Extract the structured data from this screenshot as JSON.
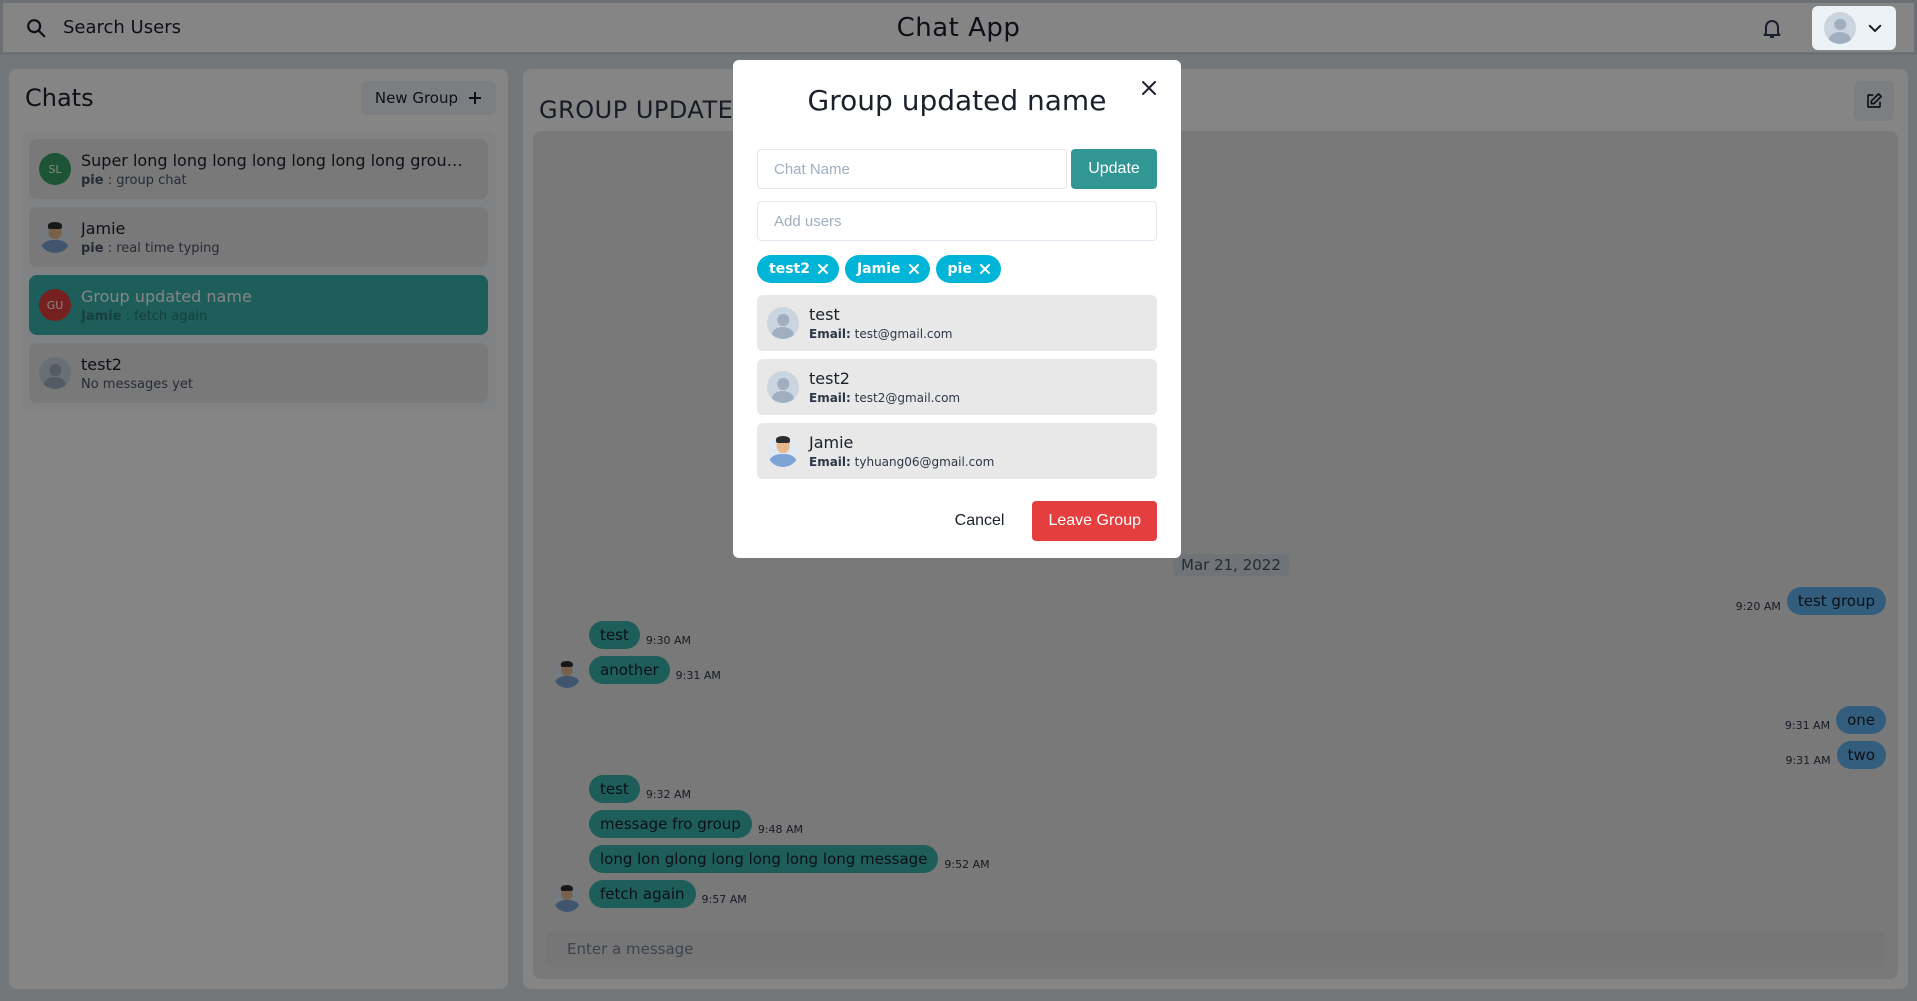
{
  "header": {
    "search_label": "Search Users",
    "app_title": "Chat App"
  },
  "chats_panel": {
    "title": "Chats",
    "new_group_label": "New Group",
    "items": [
      {
        "initials": "SL",
        "name": "Super long long long long long long long group...",
        "sender": "pie",
        "preview": "group chat",
        "avatar_color": "#38a169"
      },
      {
        "name": "Jamie",
        "sender": "pie",
        "preview": "real time typing"
      },
      {
        "initials": "GU",
        "name": "Group updated name",
        "sender": "Jamie",
        "preview": "fetch again",
        "avatar_color": "#e53e3e"
      },
      {
        "name": "test2",
        "preview": "No messages yet"
      }
    ]
  },
  "chat_panel": {
    "title": "GROUP UPDATED",
    "date_divider": "Mar 21, 2022",
    "input_placeholder": "Enter a message",
    "messages": [
      {
        "text": "test group",
        "time": "9:20 AM",
        "side": "out"
      },
      {
        "text": "test",
        "time": "9:30 AM",
        "side": "in"
      },
      {
        "text": "another",
        "time": "9:31 AM",
        "side": "in"
      },
      {
        "text": "one",
        "time": "9:31 AM",
        "side": "out"
      },
      {
        "text": "two",
        "time": "9:31 AM",
        "side": "out"
      },
      {
        "text": "test",
        "time": "9:32 AM",
        "side": "in"
      },
      {
        "text": "message fro group",
        "time": "9:48 AM",
        "side": "in"
      },
      {
        "text": "long lon glong long long long long message",
        "time": "9:52 AM",
        "side": "in"
      },
      {
        "text": "fetch again",
        "time": "9:57 AM",
        "side": "in"
      }
    ]
  },
  "modal": {
    "title": "Group updated name",
    "chat_name_placeholder": "Chat Name",
    "update_label": "Update",
    "add_users_placeholder": "Add users",
    "tags": [
      "test2",
      "Jamie",
      "pie"
    ],
    "email_prefix": "Email:",
    "users": [
      {
        "name": "test",
        "email": "test@gmail.com"
      },
      {
        "name": "test2",
        "email": "test2@gmail.com"
      },
      {
        "name": "Jamie",
        "email": "tyhuang06@gmail.com"
      }
    ],
    "cancel_label": "Cancel",
    "leave_label": "Leave Group"
  },
  "colors": {
    "teal": "#38b2ac",
    "blue_bubble": "#63b3ed",
    "tag_cyan": "#00b5d8",
    "danger": "#e53e3e"
  }
}
